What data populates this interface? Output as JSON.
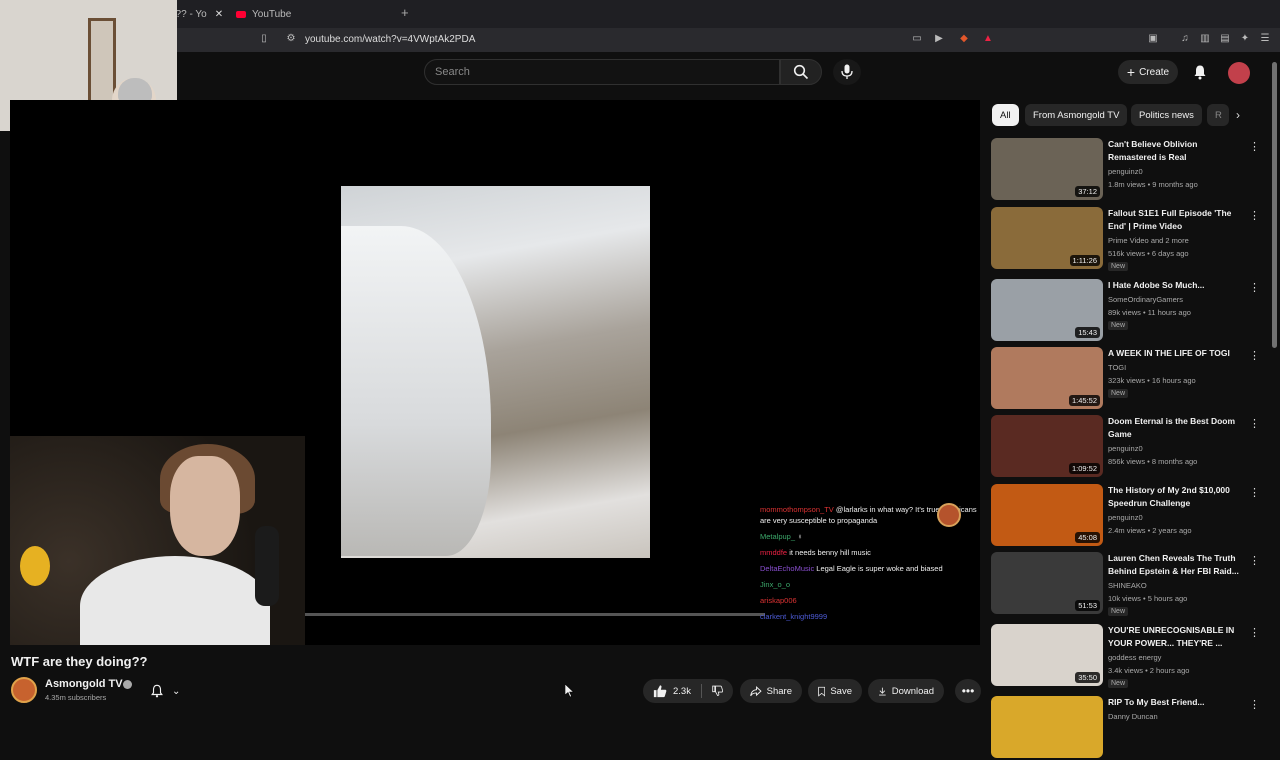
{
  "browser": {
    "active_tab_title": "g?? - Yo",
    "second_tab_title": "YouTube",
    "new_tab": "+",
    "url": "youtube.com/watch?v=4VWptAk2PDA"
  },
  "masthead": {
    "search_placeholder": "Search",
    "create_label": "Create"
  },
  "video": {
    "title": "WTF are they doing??",
    "channel_name": "Asmongold TV",
    "subscribers": "4.35m subscribers",
    "likes": "2.3k",
    "share_label": "Share",
    "save_label": "Save",
    "download_label": "Download"
  },
  "chat": [
    {
      "user": "mommothompson_TV",
      "text": "@larlarks in what way? It's true Americans are very susceptible to propaganda"
    },
    {
      "user": "Metalpup_",
      "text": "♀"
    },
    {
      "user": "mmddfe",
      "text": "it needs benny hill music"
    },
    {
      "user": "DeltaEchoMusic",
      "text": "Legal Eagle is super woke and biased"
    },
    {
      "user": "Jinx_o_o",
      "text": ""
    },
    {
      "user": "ariskap006",
      "text": ""
    },
    {
      "user": "clarkent_knight9999",
      "text": ""
    }
  ],
  "chips": [
    "All",
    "From Asmongold TV",
    "Politics news",
    "R"
  ],
  "recommendations": [
    {
      "title": "Can't Believe Oblivion Remastered is Real",
      "channel": "penguinz0",
      "stats": "1.8m views • 9 months ago",
      "duration": "37:12",
      "badge": "",
      "thumb_color": "#6b6356"
    },
    {
      "title": "Fallout S1E1 Full Episode 'The End' | Prime Video",
      "channel": "Prime Video",
      "channel_extra": "and 2 more",
      "stats": "516k views • 6 days ago",
      "duration": "1:11:26",
      "badge": "New",
      "thumb_color": "#8a6b3a"
    },
    {
      "title": "I Hate Adobe So Much...",
      "channel": "SomeOrdinaryGamers",
      "stats": "89k views • 11 hours ago",
      "duration": "15:43",
      "badge": "New",
      "thumb_color": "#9aa0a6"
    },
    {
      "title": "A WEEK IN THE LIFE OF TOGI",
      "channel": "TOGI",
      "stats": "323k views • 16 hours ago",
      "duration": "1:45:52",
      "badge": "New",
      "thumb_color": "#b07a5e"
    },
    {
      "title": "Doom Eternal is the Best Doom Game",
      "channel": "penguinz0",
      "stats": "856k views • 8 months ago",
      "duration": "1:09:52",
      "badge": "",
      "thumb_color": "#5a2a22"
    },
    {
      "title": "The History of My 2nd $10,000 Speedrun Challenge",
      "channel": "penguinz0",
      "stats": "2.4m views • 2 years ago",
      "duration": "45:08",
      "badge": "",
      "thumb_color": "#c25a14"
    },
    {
      "title": "Lauren Chen Reveals The Truth Behind Epstein & Her FBI Raid...",
      "channel": "SHINEAKO",
      "stats": "10k views • 5 hours ago",
      "duration": "51:53",
      "badge": "New",
      "thumb_color": "#3a3a3a"
    },
    {
      "title": "YOU'RE UNRECOGNISABLE IN YOUR POWER... THEY'RE ...",
      "channel": "goddess energy",
      "stats": "3.4k views • 2 hours ago",
      "duration": "35:50",
      "badge": "New",
      "thumb_color": "#d9d3cc"
    },
    {
      "title": "RIP To My Best Friend...",
      "channel": "Danny Duncan",
      "stats": "",
      "duration": "",
      "badge": "",
      "thumb_color": "#d9a82a"
    }
  ],
  "colors": {
    "accent": "#ff0033",
    "page_bg": "#0f0f0f",
    "chip_active": "#f1f1f1"
  }
}
